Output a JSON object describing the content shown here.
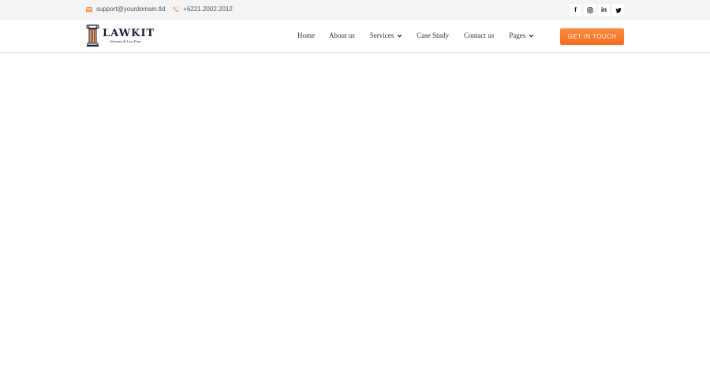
{
  "topbar": {
    "email": "support@yourdomain.tld",
    "phone": "+6221.2002.2012",
    "email_icon": "envelope-icon",
    "phone_icon": "phone-icon",
    "social": [
      {
        "name": "facebook-icon",
        "glyph": "f"
      },
      {
        "name": "instagram-icon",
        "glyph": ""
      },
      {
        "name": "linkedin-icon",
        "glyph": "in"
      },
      {
        "name": "twitter-icon",
        "glyph": ""
      }
    ]
  },
  "header": {
    "logo_text": "LAWKIT",
    "logo_tagline": "Attorney & Law Firm",
    "nav": [
      {
        "label": "Home",
        "dropdown": false
      },
      {
        "label": "About us",
        "dropdown": false
      },
      {
        "label": "Services",
        "dropdown": true
      },
      {
        "label": "Case Study",
        "dropdown": false
      },
      {
        "label": "Contact us",
        "dropdown": false
      },
      {
        "label": "Pages",
        "dropdown": true
      }
    ],
    "cta_label": "GET IN TOUCH"
  },
  "colors": {
    "accent": "#f36c1c",
    "topbar_bg": "#f3f4f6",
    "brand_navy": "#1a1f3a"
  }
}
